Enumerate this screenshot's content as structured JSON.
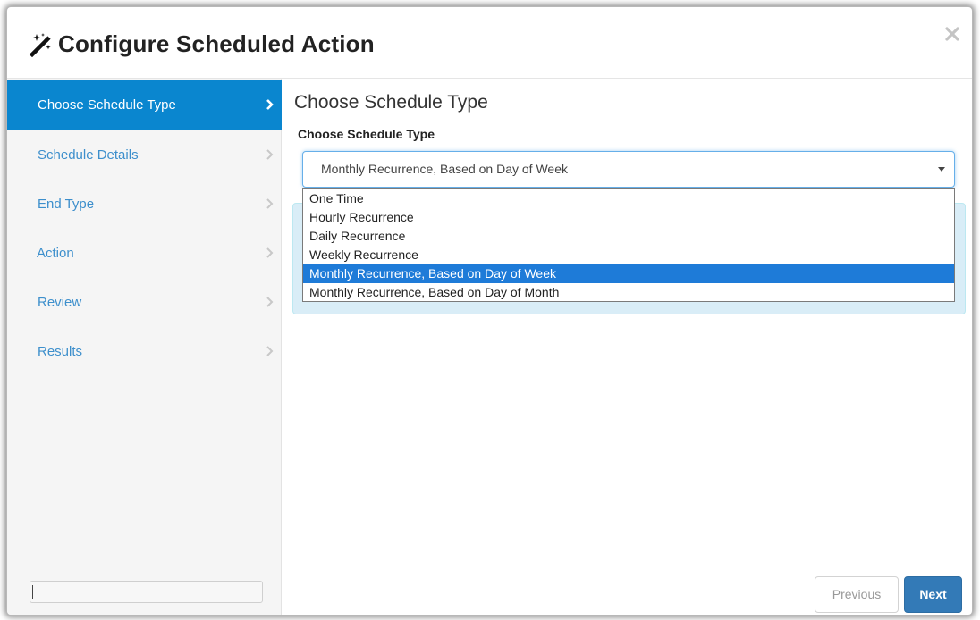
{
  "dialog": {
    "title": "Configure Scheduled Action",
    "icons": {
      "title_icon": "magic-wand-icon",
      "close_icon": "close-icon"
    }
  },
  "sidebar": {
    "items": [
      {
        "label": "Choose Schedule Type",
        "active": true
      },
      {
        "label": "Schedule Details",
        "active": false
      },
      {
        "label": "End Type",
        "active": false
      },
      {
        "label": "Action",
        "active": false
      },
      {
        "label": "Review",
        "active": false
      },
      {
        "label": "Results",
        "active": false
      }
    ],
    "input_value": ""
  },
  "main": {
    "heading": "Choose Schedule Type",
    "field_label": "Choose Schedule Type",
    "select": {
      "value": "Monthly Recurrence, Based on Day of Week",
      "options": [
        "One Time",
        "Hourly Recurrence",
        "Daily Recurrence",
        "Weekly Recurrence",
        "Monthly Recurrence, Based on Day of Week",
        "Monthly Recurrence, Based on Day of Month"
      ],
      "selected_index": 4
    }
  },
  "footer": {
    "previous_label": "Previous",
    "next_label": "Next"
  },
  "colors": {
    "accent": "#0a86cf",
    "link": "#3d8fcc",
    "primary_button": "#337ab7",
    "info_box": "#d9edf7",
    "option_highlight": "#1e7bd8"
  }
}
